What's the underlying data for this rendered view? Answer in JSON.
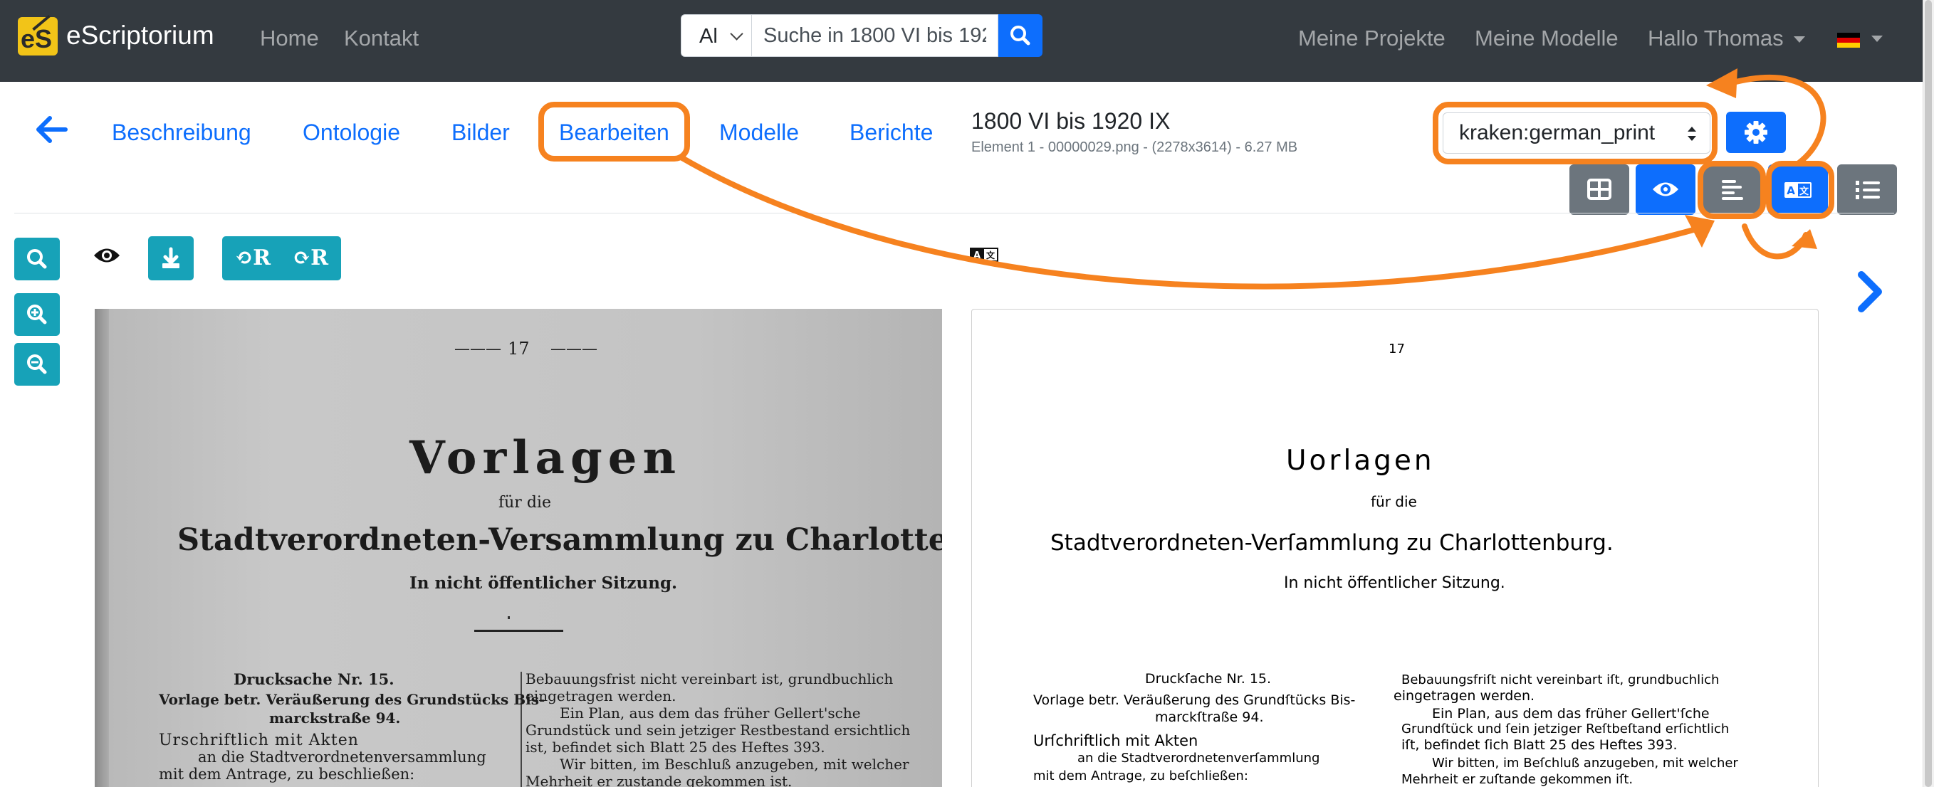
{
  "app": {
    "brand": "eScriptorium",
    "nav": {
      "home": "Home",
      "contact": "Kontakt"
    },
    "search": {
      "scope": "Al",
      "value": "Suche in 1800 VI bis 192"
    },
    "nav_right": {
      "projects": "Meine Projekte",
      "models": "Meine Modelle",
      "user": "Hallo Thomas"
    }
  },
  "document": {
    "tabs": [
      "Beschreibung",
      "Ontologie",
      "Bilder",
      "Bearbeiten",
      "Modelle",
      "Berichte"
    ],
    "active_tab": "Bearbeiten",
    "title": "1800 VI bis 1920 IX",
    "meta": "Element 1 - 00000029.png - (2278x3614) - 6.27 MB",
    "model": "kraken:german_print"
  },
  "icons": [
    "back-arrow-icon",
    "search-icon",
    "gear-icon",
    "table-icon",
    "eye-icon",
    "align-left-icon",
    "translate-icon",
    "ordered-list-icon",
    "zoom-in-icon",
    "zoom-out-icon",
    "download-icon",
    "rotate-left-icon",
    "rotate-right-icon",
    "chevron-right-icon",
    "german-flag-icon"
  ],
  "colors": {
    "navbar": "#343a40",
    "primary": "#0d6efd",
    "info": "#17a2b8",
    "secondary": "#6c757d",
    "annotation": "#f6821f"
  },
  "viewer": {
    "rotate_left": "⟲R",
    "rotate_right": "⟳R"
  },
  "scan": {
    "page_no": "17",
    "dashes_left": "———",
    "dashes_right": "———",
    "title": "Vorlagen",
    "fuer_die": "für die",
    "heading": "Stadtverordneten-Versammlung zu Charlottenburg.",
    "subheading": "In nicht öffentlicher Sitzung.",
    "left_col": [
      "Drucksache Nr. 15.",
      "Vorlage betr. Veräußerung des Grundstücks Bis-",
      "marckstraße 94.",
      "Urschriftlich mit Akten",
      "an die Stadtverordnetenversammlung",
      "mit dem Antrage, zu beschließen:"
    ],
    "right_col": [
      "Bebauungsfrist nicht vereinbart ist, grundbuchlich",
      "eingetragen werden.",
      "Ein Plan, aus dem das früher Gellert'sche",
      "Grundstück und sein jetziger Restbestand ersichtlich",
      "ist, befindet sich Blatt 25 des Heftes 393.",
      "Wir bitten, im Beschluß anzugeben, mit welcher",
      "Mehrheit er zustande gekommen ist."
    ]
  },
  "transcription": {
    "page_no": "17",
    "title": "Uorlagen",
    "fuer_die": "für die",
    "heading": "Stadtverordneten-Verſammlung zu Charlottenburg.",
    "subheading": "In nicht öffentlicher Sitzung.",
    "left_col": [
      "Druckſache Nr. 15.",
      "Vorlage betr. Veräußerung des Grundſtücks Bis-",
      "marckſtraße 94.",
      "Urſchriftlich mit Akten",
      "an die Stadtverordnetenverſammlung",
      "mit dem Antrage, zu beſchließen:"
    ],
    "right_col": [
      "Bebauungsfriſt nicht vereinbart iſt, grundbuchlich",
      "eingetragen werden.",
      "Ein Plan, aus dem das früher Gellert'ſche",
      "Grundſtück und ſein jetziger Reſtbeſtand erſichtlich",
      "iſt, befindet ſich Blatt 25 des Heftes 393.",
      "Wir bitten, im Beſchluß anzugeben, mit welcher",
      "Mehrheit er zuſtande gekommen iſt."
    ]
  }
}
